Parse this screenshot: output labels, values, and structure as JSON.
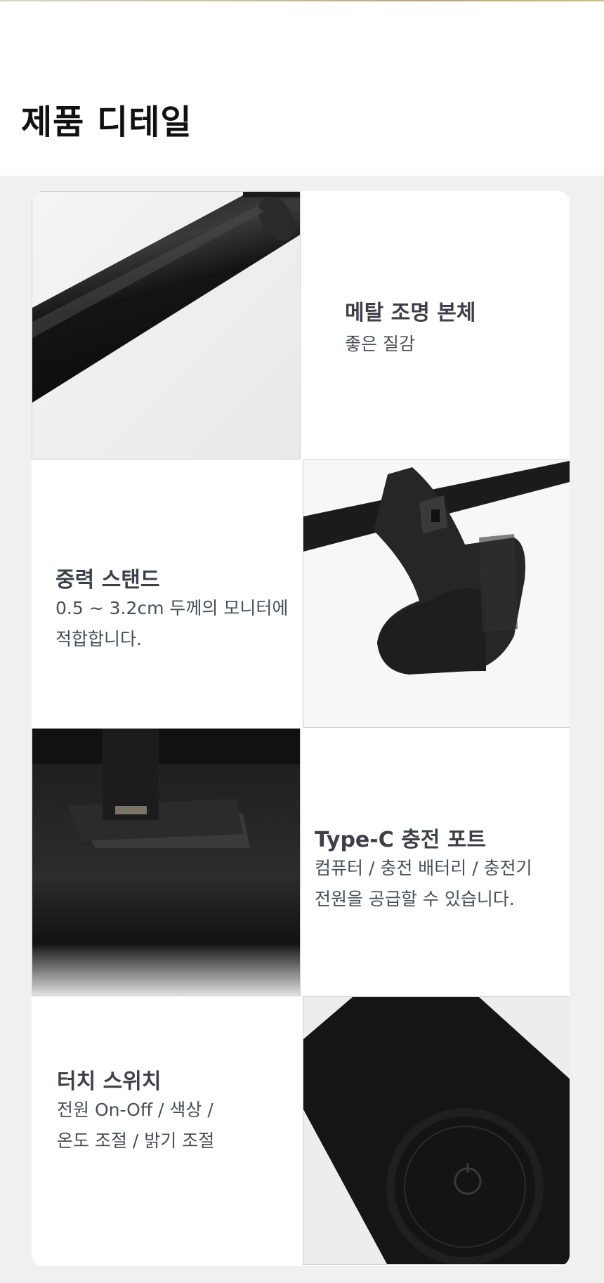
{
  "page_title": "제품 디테일",
  "features": [
    {
      "title": "메탈 조명 본체",
      "desc_lines": [
        "좋은 질감"
      ],
      "image": "metal-lamp-body-photo"
    },
    {
      "title": "중력 스탠드",
      "desc_lines": [
        "0.5 ~ 3.2cm 두께의 모니터에",
        "적합합니다."
      ],
      "image": "gravity-stand-photo"
    },
    {
      "title": "Type-C 충전 포트",
      "desc_lines": [
        "컴퓨터 / 충전 배터리 / 충전기",
        "전원을 공급할 수 있습니다."
      ],
      "image": "type-c-port-photo"
    },
    {
      "title": "터치 스위치",
      "desc_lines": [
        "전원 On-Off / 색상 /",
        "온도 조절 / 밝기 조절"
      ],
      "image": "touch-switch-photo"
    }
  ],
  "colors": {
    "section_bg": "#f0f0f0",
    "title": "#111111",
    "feature_title": "#3d4049",
    "feature_desc": "#4a4d55"
  }
}
